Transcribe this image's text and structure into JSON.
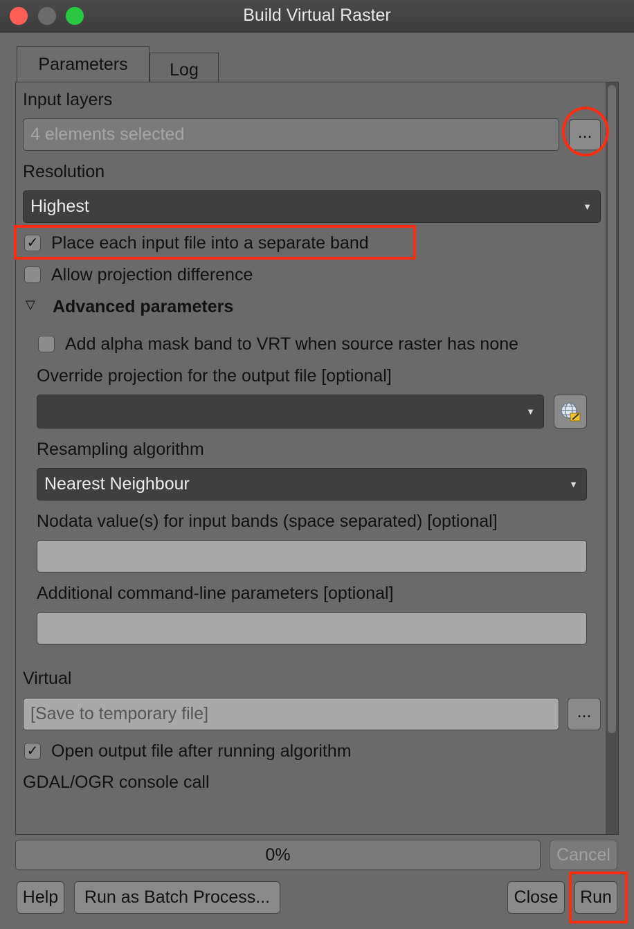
{
  "window": {
    "title": "Build Virtual Raster"
  },
  "tabs": [
    {
      "label": "Parameters"
    },
    {
      "label": "Log"
    }
  ],
  "input_layers": {
    "label": "Input layers",
    "value": "4 elements selected",
    "browse": "..."
  },
  "resolution": {
    "label": "Resolution",
    "value": "Highest"
  },
  "separate_band": {
    "label": "Place each input file into a separate band",
    "checked": true
  },
  "allow_projection": {
    "label": "Allow projection difference",
    "checked": false
  },
  "advanced": {
    "label": "Advanced parameters",
    "alpha_mask": {
      "label": "Add alpha mask band to VRT when source raster has none",
      "checked": false
    },
    "override_projection": {
      "label": "Override projection for the output file [optional]",
      "value": ""
    },
    "resampling": {
      "label": "Resampling algorithm",
      "value": "Nearest Neighbour"
    },
    "nodata": {
      "label": "Nodata value(s) for input bands (space separated) [optional]",
      "value": ""
    },
    "extra": {
      "label": "Additional command-line parameters [optional]",
      "value": ""
    }
  },
  "virtual": {
    "label": "Virtual",
    "placeholder": "[Save to temporary file]",
    "browse": "..."
  },
  "open_output": {
    "label": "Open output file after running algorithm",
    "checked": true
  },
  "console": {
    "label": "GDAL/OGR console call"
  },
  "progress": {
    "text": "0%",
    "value": 0
  },
  "buttons": {
    "cancel": "Cancel",
    "help": "Help",
    "batch": "Run as Batch Process...",
    "close": "Close",
    "run": "Run"
  },
  "colors": {
    "highlight": "#ff2a0f",
    "close": "#ff5f57",
    "maximize": "#28c840"
  }
}
